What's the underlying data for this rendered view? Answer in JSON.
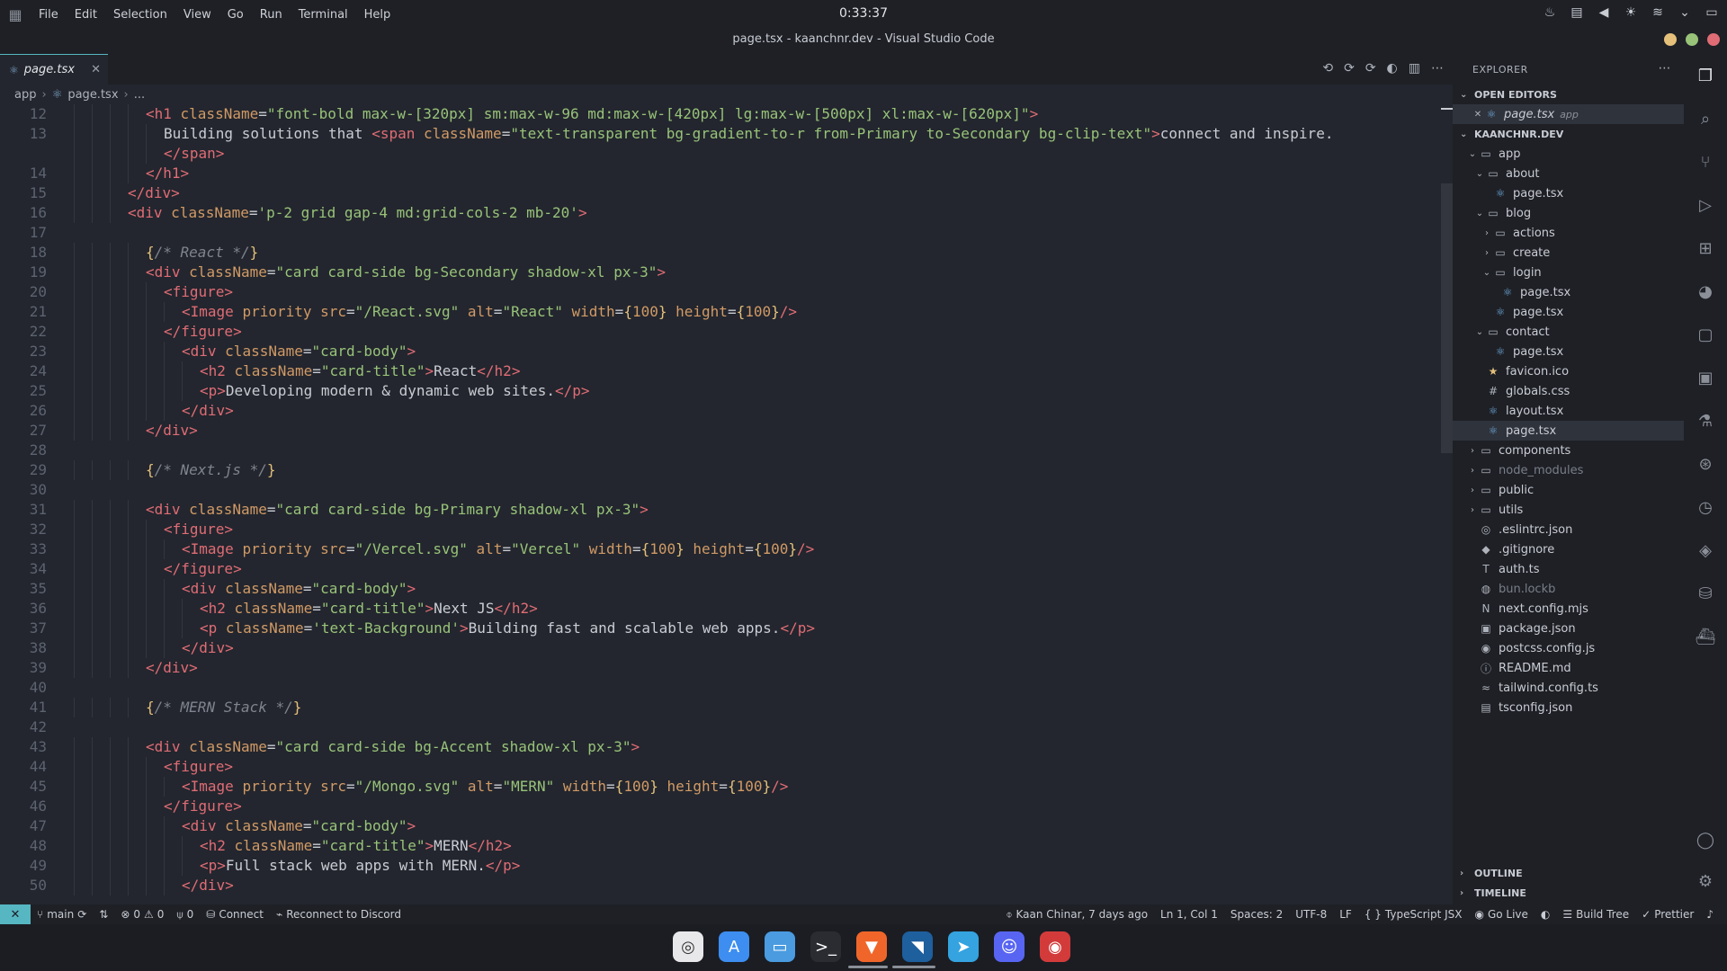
{
  "system": {
    "clock": "0:33:37",
    "menus": [
      "File",
      "Edit",
      "Selection",
      "View",
      "Go",
      "Run",
      "Terminal",
      "Help"
    ]
  },
  "window": {
    "title": "page.tsx - kaanchnr.dev - Visual Studio Code"
  },
  "colors": {
    "accent": "#56b6c2",
    "close": "#e06c75",
    "maximize": "#98c379",
    "minimize": "#e5c07b"
  },
  "editor": {
    "tab": {
      "label": "page.tsx",
      "icon": "react-icon"
    },
    "breadcrumb": [
      "app",
      "page.tsx",
      "..."
    ],
    "lines": [
      {
        "n": "12",
        "ind": 4
      },
      {
        "n": "13",
        "ind": 5
      },
      {
        "n": "",
        "ind": 5
      },
      {
        "n": "14",
        "ind": 4
      },
      {
        "n": "15",
        "ind": 3
      },
      {
        "n": "16",
        "ind": 3
      },
      {
        "n": "17",
        "ind": 0
      },
      {
        "n": "18",
        "ind": 4
      },
      {
        "n": "19",
        "ind": 4
      },
      {
        "n": "20",
        "ind": 5
      },
      {
        "n": "21",
        "ind": 6
      },
      {
        "n": "22",
        "ind": 5
      },
      {
        "n": "23",
        "ind": 6
      },
      {
        "n": "24",
        "ind": 7
      },
      {
        "n": "25",
        "ind": 7
      },
      {
        "n": "26",
        "ind": 6
      },
      {
        "n": "27",
        "ind": 4
      },
      {
        "n": "28",
        "ind": 0
      },
      {
        "n": "29",
        "ind": 4
      },
      {
        "n": "30",
        "ind": 0
      },
      {
        "n": "31",
        "ind": 4
      },
      {
        "n": "32",
        "ind": 5
      },
      {
        "n": "33",
        "ind": 6
      },
      {
        "n": "34",
        "ind": 5
      },
      {
        "n": "35",
        "ind": 6
      },
      {
        "n": "36",
        "ind": 7
      },
      {
        "n": "37",
        "ind": 7
      },
      {
        "n": "38",
        "ind": 6
      },
      {
        "n": "39",
        "ind": 4
      },
      {
        "n": "40",
        "ind": 0
      },
      {
        "n": "41",
        "ind": 4
      },
      {
        "n": "42",
        "ind": 0
      },
      {
        "n": "43",
        "ind": 4
      },
      {
        "n": "44",
        "ind": 5
      },
      {
        "n": "45",
        "ind": 6
      },
      {
        "n": "46",
        "ind": 5
      },
      {
        "n": "47",
        "ind": 6
      },
      {
        "n": "48",
        "ind": 7
      },
      {
        "n": "49",
        "ind": 7
      },
      {
        "n": "50",
        "ind": 6
      }
    ],
    "code": [
      [
        [
          "tg",
          "<h1 "
        ],
        [
          "at",
          "className"
        ],
        [
          "pc",
          "="
        ],
        [
          "st",
          "\"font-bold max-w-[320px] sm:max-w-96 md:max-w-[420px] lg:max-w-[500px] xl:max-w-[620px]\""
        ],
        [
          "tg",
          ">"
        ]
      ],
      [
        [
          "pc",
          "Building solutions that "
        ],
        [
          "tg",
          "<span "
        ],
        [
          "at",
          "className"
        ],
        [
          "pc",
          "="
        ],
        [
          "st",
          "\"text-transparent bg-gradient-to-r from-Primary to-Secondary bg-clip-text\""
        ],
        [
          "tg",
          ">"
        ],
        [
          "pc",
          "connect and inspire."
        ]
      ],
      [
        [
          "tg",
          "</span>"
        ]
      ],
      [
        [
          "tg",
          "</h1>"
        ]
      ],
      [
        [
          "tg",
          "</div>"
        ]
      ],
      [
        [
          "tg",
          "<div "
        ],
        [
          "at",
          "className"
        ],
        [
          "pc",
          "="
        ],
        [
          "st",
          "'p-2 grid gap-4 md:grid-cols-2 mb-20'"
        ],
        [
          "tg",
          ">"
        ]
      ],
      [],
      [
        [
          "br",
          "{"
        ],
        [
          "cm",
          "/* React */"
        ],
        [
          "br",
          "}"
        ]
      ],
      [
        [
          "tg",
          "<div "
        ],
        [
          "at",
          "className"
        ],
        [
          "pc",
          "="
        ],
        [
          "st",
          "\"card card-side bg-Secondary shadow-xl px-3\""
        ],
        [
          "tg",
          ">"
        ]
      ],
      [
        [
          "tg",
          "<figure>"
        ]
      ],
      [
        [
          "tg",
          "<Image "
        ],
        [
          "at",
          "priority src"
        ],
        [
          "pc",
          "="
        ],
        [
          "st",
          "\"/React.svg\""
        ],
        [
          "at",
          " alt"
        ],
        [
          "pc",
          "="
        ],
        [
          "st",
          "\"React\""
        ],
        [
          "at",
          " width"
        ],
        [
          "pc",
          "="
        ],
        [
          "br",
          "{"
        ],
        [
          "at",
          "100"
        ],
        [
          "br",
          "}"
        ],
        [
          "at",
          " height"
        ],
        [
          "pc",
          "="
        ],
        [
          "br",
          "{"
        ],
        [
          "at",
          "100"
        ],
        [
          "br",
          "}"
        ],
        [
          "tg",
          "/>"
        ]
      ],
      [
        [
          "tg",
          "</figure>"
        ]
      ],
      [
        [
          "tg",
          "<div "
        ],
        [
          "at",
          "className"
        ],
        [
          "pc",
          "="
        ],
        [
          "st",
          "\"card-body\""
        ],
        [
          "tg",
          ">"
        ]
      ],
      [
        [
          "tg",
          "<h2 "
        ],
        [
          "at",
          "className"
        ],
        [
          "pc",
          "="
        ],
        [
          "st",
          "\"card-title\""
        ],
        [
          "tg",
          ">"
        ],
        [
          "pc",
          "React"
        ],
        [
          "tg",
          "</h2>"
        ]
      ],
      [
        [
          "tg",
          "<p>"
        ],
        [
          "pc",
          "Developing modern & dynamic web sites."
        ],
        [
          "tg",
          "</p>"
        ]
      ],
      [
        [
          "tg",
          "</div>"
        ]
      ],
      [
        [
          "tg",
          "</div>"
        ]
      ],
      [],
      [
        [
          "br",
          "{"
        ],
        [
          "cm",
          "/* Next.js */"
        ],
        [
          "br",
          "}"
        ]
      ],
      [],
      [
        [
          "tg",
          "<div "
        ],
        [
          "at",
          "className"
        ],
        [
          "pc",
          "="
        ],
        [
          "st",
          "\"card card-side bg-Primary shadow-xl px-3\""
        ],
        [
          "tg",
          ">"
        ]
      ],
      [
        [
          "tg",
          "<figure>"
        ]
      ],
      [
        [
          "tg",
          "<Image "
        ],
        [
          "at",
          "priority src"
        ],
        [
          "pc",
          "="
        ],
        [
          "st",
          "\"/Vercel.svg\""
        ],
        [
          "at",
          " alt"
        ],
        [
          "pc",
          "="
        ],
        [
          "st",
          "\"Vercel\""
        ],
        [
          "at",
          " width"
        ],
        [
          "pc",
          "="
        ],
        [
          "br",
          "{"
        ],
        [
          "at",
          "100"
        ],
        [
          "br",
          "}"
        ],
        [
          "at",
          " height"
        ],
        [
          "pc",
          "="
        ],
        [
          "br",
          "{"
        ],
        [
          "at",
          "100"
        ],
        [
          "br",
          "}"
        ],
        [
          "tg",
          "/>"
        ]
      ],
      [
        [
          "tg",
          "</figure>"
        ]
      ],
      [
        [
          "tg",
          "<div "
        ],
        [
          "at",
          "className"
        ],
        [
          "pc",
          "="
        ],
        [
          "st",
          "\"card-body\""
        ],
        [
          "tg",
          ">"
        ]
      ],
      [
        [
          "tg",
          "<h2 "
        ],
        [
          "at",
          "className"
        ],
        [
          "pc",
          "="
        ],
        [
          "st",
          "\"card-title\""
        ],
        [
          "tg",
          ">"
        ],
        [
          "pc",
          "Next JS"
        ],
        [
          "tg",
          "</h2>"
        ]
      ],
      [
        [
          "tg",
          "<p "
        ],
        [
          "at",
          "className"
        ],
        [
          "pc",
          "="
        ],
        [
          "st",
          "'text-Background'"
        ],
        [
          "tg",
          ">"
        ],
        [
          "pc",
          "Building fast and scalable web apps."
        ],
        [
          "tg",
          "</p>"
        ]
      ],
      [
        [
          "tg",
          "</div>"
        ]
      ],
      [
        [
          "tg",
          "</div>"
        ]
      ],
      [],
      [
        [
          "br",
          "{"
        ],
        [
          "cm",
          "/* MERN Stack */"
        ],
        [
          "br",
          "}"
        ]
      ],
      [],
      [
        [
          "tg",
          "<div "
        ],
        [
          "at",
          "className"
        ],
        [
          "pc",
          "="
        ],
        [
          "st",
          "\"card card-side bg-Accent shadow-xl px-3\""
        ],
        [
          "tg",
          ">"
        ]
      ],
      [
        [
          "tg",
          "<figure>"
        ]
      ],
      [
        [
          "tg",
          "<Image "
        ],
        [
          "at",
          "priority src"
        ],
        [
          "pc",
          "="
        ],
        [
          "st",
          "\"/Mongo.svg\""
        ],
        [
          "at",
          " alt"
        ],
        [
          "pc",
          "="
        ],
        [
          "st",
          "\"MERN\""
        ],
        [
          "at",
          " width"
        ],
        [
          "pc",
          "="
        ],
        [
          "br",
          "{"
        ],
        [
          "at",
          "100"
        ],
        [
          "br",
          "}"
        ],
        [
          "at",
          " height"
        ],
        [
          "pc",
          "="
        ],
        [
          "br",
          "{"
        ],
        [
          "at",
          "100"
        ],
        [
          "br",
          "}"
        ],
        [
          "tg",
          "/>"
        ]
      ],
      [
        [
          "tg",
          "</figure>"
        ]
      ],
      [
        [
          "tg",
          "<div "
        ],
        [
          "at",
          "className"
        ],
        [
          "pc",
          "="
        ],
        [
          "st",
          "\"card-body\""
        ],
        [
          "tg",
          ">"
        ]
      ],
      [
        [
          "tg",
          "<h2 "
        ],
        [
          "at",
          "className"
        ],
        [
          "pc",
          "="
        ],
        [
          "st",
          "\"card-title\""
        ],
        [
          "tg",
          ">"
        ],
        [
          "pc",
          "MERN"
        ],
        [
          "tg",
          "</h2>"
        ]
      ],
      [
        [
          "tg",
          "<p>"
        ],
        [
          "pc",
          "Full stack web apps with MERN."
        ],
        [
          "tg",
          "</p>"
        ]
      ],
      [
        [
          "tg",
          "</div>"
        ]
      ]
    ]
  },
  "explorer": {
    "title": "EXPLORER",
    "open_editors_label": "OPEN EDITORS",
    "open_editor": {
      "name": "page.tsx",
      "folder": "app"
    },
    "project_label": "KAANCHNR.DEV",
    "tree": [
      {
        "depth": 1,
        "type": "folder",
        "open": true,
        "name": "app",
        "icon": "folder-icon"
      },
      {
        "depth": 2,
        "type": "folder",
        "open": true,
        "name": "about",
        "icon": "folder-icon"
      },
      {
        "depth": 3,
        "type": "file",
        "name": "page.tsx",
        "icon": "react-icon"
      },
      {
        "depth": 2,
        "type": "folder",
        "open": true,
        "name": "blog",
        "icon": "folder-icon"
      },
      {
        "depth": 3,
        "type": "folder",
        "open": false,
        "name": "actions",
        "icon": "folder-icon"
      },
      {
        "depth": 3,
        "type": "folder",
        "open": false,
        "name": "create",
        "icon": "folder-icon"
      },
      {
        "depth": 3,
        "type": "folder",
        "open": true,
        "name": "login",
        "icon": "folder-icon"
      },
      {
        "depth": 4,
        "type": "file",
        "name": "page.tsx",
        "icon": "react-icon"
      },
      {
        "depth": 3,
        "type": "file",
        "name": "page.tsx",
        "icon": "react-icon"
      },
      {
        "depth": 2,
        "type": "folder",
        "open": true,
        "name": "contact",
        "icon": "folder-icon"
      },
      {
        "depth": 3,
        "type": "file",
        "name": "page.tsx",
        "icon": "react-icon"
      },
      {
        "depth": 2,
        "type": "file",
        "name": "favicon.ico",
        "icon": "star-icon"
      },
      {
        "depth": 2,
        "type": "file",
        "name": "globals.css",
        "icon": "css-icon"
      },
      {
        "depth": 2,
        "type": "file",
        "name": "layout.tsx",
        "icon": "react-icon"
      },
      {
        "depth": 2,
        "type": "file",
        "name": "page.tsx",
        "icon": "react-icon",
        "selected": true
      },
      {
        "depth": 1,
        "type": "folder",
        "open": false,
        "name": "components",
        "icon": "folder-icon"
      },
      {
        "depth": 1,
        "type": "folder",
        "open": false,
        "name": "node_modules",
        "icon": "folder-icon",
        "dim": true
      },
      {
        "depth": 1,
        "type": "folder",
        "open": false,
        "name": "public",
        "icon": "folder-icon"
      },
      {
        "depth": 1,
        "type": "folder",
        "open": false,
        "name": "utils",
        "icon": "folder-icon"
      },
      {
        "depth": 1,
        "type": "file",
        "name": ".eslintrc.json",
        "icon": "eslint-icon"
      },
      {
        "depth": 1,
        "type": "file",
        "name": ".gitignore",
        "icon": "git-icon"
      },
      {
        "depth": 1,
        "type": "file",
        "name": "auth.ts",
        "icon": "ts-icon"
      },
      {
        "depth": 1,
        "type": "file",
        "name": "bun.lockb",
        "icon": "bun-icon",
        "dim": true
      },
      {
        "depth": 1,
        "type": "file",
        "name": "next.config.mjs",
        "icon": "next-icon"
      },
      {
        "depth": 1,
        "type": "file",
        "name": "package.json",
        "icon": "npm-icon"
      },
      {
        "depth": 1,
        "type": "file",
        "name": "postcss.config.js",
        "icon": "postcss-icon"
      },
      {
        "depth": 1,
        "type": "file",
        "name": "README.md",
        "icon": "info-icon"
      },
      {
        "depth": 1,
        "type": "file",
        "name": "tailwind.config.ts",
        "icon": "tailwind-icon"
      },
      {
        "depth": 1,
        "type": "file",
        "name": "tsconfig.json",
        "icon": "tsconfig-icon"
      }
    ],
    "outline_label": "OUTLINE",
    "timeline_label": "TIMELINE"
  },
  "statusbar": {
    "branch": "main",
    "errors": "0",
    "warnings": "0",
    "ports": "0",
    "connect": "Connect",
    "discord": "Reconnect to Discord",
    "blame": "Kaan Chinar, 7 days ago",
    "position": "Ln 1, Col 1",
    "spaces": "Spaces: 2",
    "encoding": "UTF-8",
    "eol": "LF",
    "language": "TypeScript JSX",
    "golive": "Go Live",
    "buildtree": "Build Tree",
    "prettier": "Prettier"
  },
  "dock": [
    {
      "name": "chrome-icon",
      "glyph": "◎",
      "bg": "#e8e8ea"
    },
    {
      "name": "app-store-icon",
      "glyph": "A",
      "bg": "#3d8ef0"
    },
    {
      "name": "files-icon",
      "glyph": "▭",
      "bg": "#4a9be0"
    },
    {
      "name": "terminal-icon",
      "glyph": ">_",
      "bg": "#2a2c32"
    },
    {
      "name": "brave-icon",
      "glyph": "▼",
      "bg": "#f0662a"
    },
    {
      "name": "vscode-icon",
      "glyph": "◥",
      "bg": "#1e5f9e"
    },
    {
      "name": "telegram-icon",
      "glyph": "➤",
      "bg": "#34a3e0"
    },
    {
      "name": "discord-icon",
      "glyph": "☺",
      "bg": "#5865f2"
    },
    {
      "name": "ghost-icon",
      "glyph": "◉",
      "bg": "#d33b3b"
    }
  ]
}
